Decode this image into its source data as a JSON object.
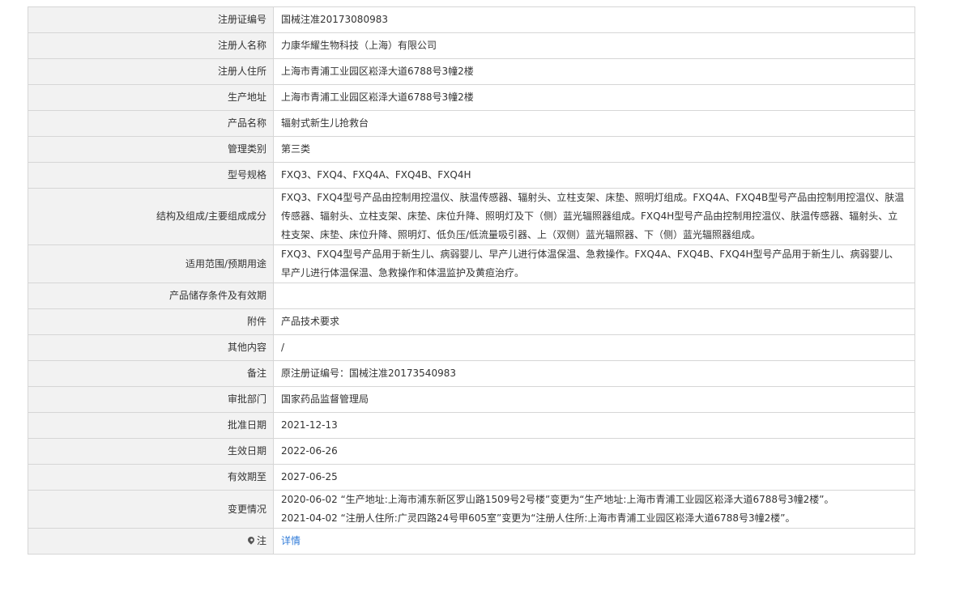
{
  "rows": [
    {
      "label": "注册证编号",
      "value": "国械注准20173080983"
    },
    {
      "label": "注册人名称",
      "value": "力康华耀生物科技（上海）有限公司"
    },
    {
      "label": "注册人住所",
      "value": "上海市青浦工业园区崧泽大道6788号3幢2楼"
    },
    {
      "label": "生产地址",
      "value": "上海市青浦工业园区崧泽大道6788号3幢2楼"
    },
    {
      "label": "产品名称",
      "value": "辐射式新生儿抢救台"
    },
    {
      "label": "管理类别",
      "value": "第三类"
    },
    {
      "label": "型号规格",
      "value": "FXQ3、FXQ4、FXQ4A、FXQ4B、FXQ4H"
    },
    {
      "label": "结构及组成/主要组成成分",
      "value": "FXQ3、FXQ4型号产品由控制用控温仪、肤温传感器、辐射头、立柱支架、床垫、照明灯组成。FXQ4A、FXQ4B型号产品由控制用控温仪、肤温传感器、辐射头、立柱支架、床垫、床位升降、照明灯及下（侧）蓝光辐照器组成。FXQ4H型号产品由控制用控温仪、肤温传感器、辐射头、立柱支架、床垫、床位升降、照明灯、低负压/低流量吸引器、上（双侧）蓝光辐照器、下（侧）蓝光辐照器组成。"
    },
    {
      "label": "适用范围/预期用途",
      "value": "FXQ3、FXQ4型号产品用于新生儿、病弱婴儿、早产儿进行体温保温、急救操作。FXQ4A、FXQ4B、FXQ4H型号产品用于新生儿、病弱婴儿、早产儿进行体温保温、急救操作和体温监护及黄疸治疗。"
    },
    {
      "label": "产品储存条件及有效期",
      "value": ""
    },
    {
      "label": "附件",
      "value": "产品技术要求"
    },
    {
      "label": "其他内容",
      "value": "/"
    },
    {
      "label": "备注",
      "value": "原注册证编号：国械注准20173540983"
    },
    {
      "label": "审批部门",
      "value": "国家药品监督管理局"
    },
    {
      "label": "批准日期",
      "value": "2021-12-13"
    },
    {
      "label": "生效日期",
      "value": "2022-06-26"
    },
    {
      "label": "有效期至",
      "value": "2027-06-25"
    }
  ],
  "changes": {
    "label": "变更情况",
    "lines": [
      "2020-06-02 “生产地址:上海市浦东新区罗山路1509号2号楼”变更为“生产地址:上海市青浦工业园区崧泽大道6788号3幢2楼”。",
      "2021-04-02 “注册人住所:广灵四路24号甲605室”变更为“注册人住所:上海市青浦工业园区崧泽大道6788号3幢2楼”。"
    ]
  },
  "note": {
    "icon": "location-pin-icon",
    "label": "注",
    "link": "详情",
    "link_color": "#2f7bd8"
  }
}
